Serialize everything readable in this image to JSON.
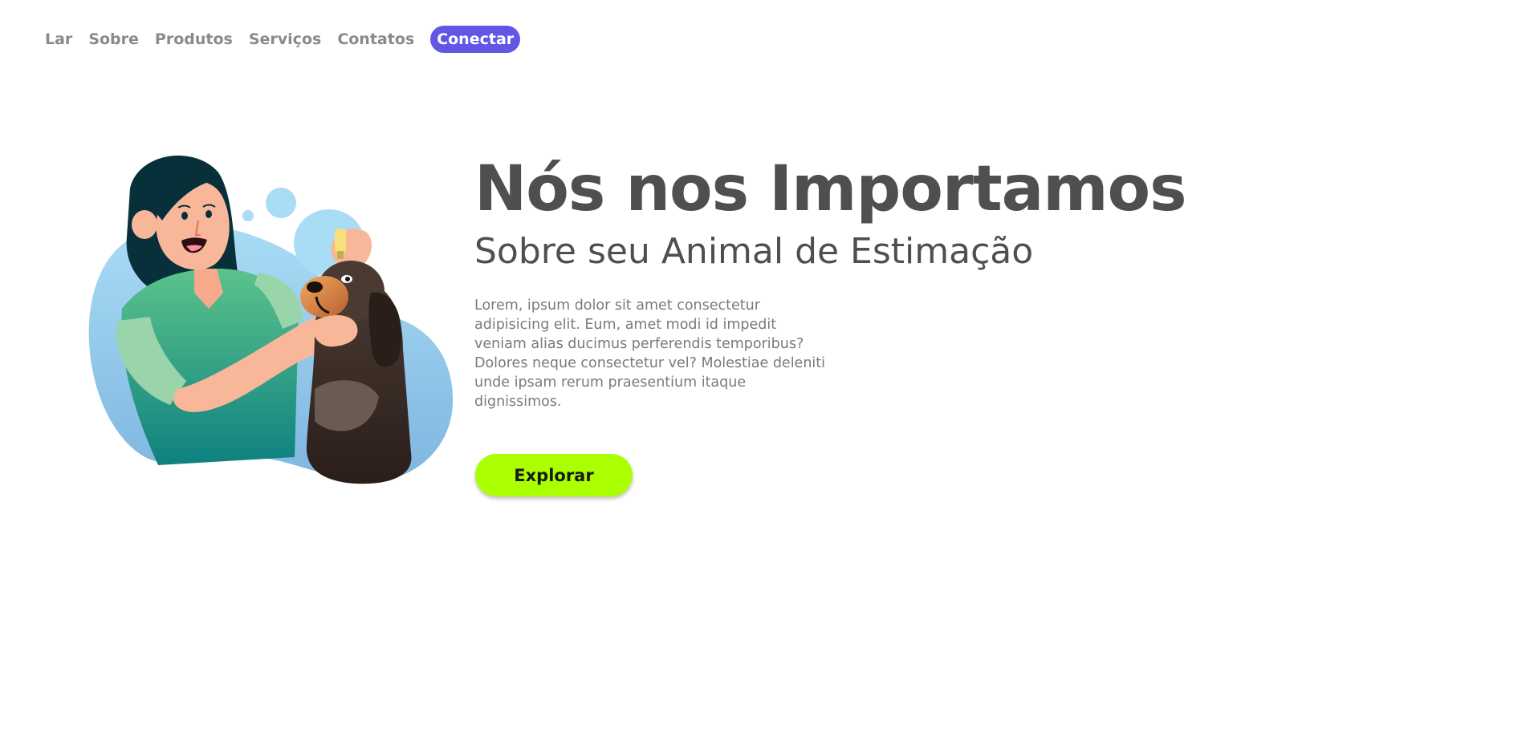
{
  "nav": {
    "items": [
      {
        "label": "Lar"
      },
      {
        "label": "Sobre"
      },
      {
        "label": "Produtos"
      },
      {
        "label": "Serviços"
      },
      {
        "label": "Contatos"
      }
    ],
    "cta_label": "Conectar"
  },
  "hero": {
    "title": "Nós nos Importamos",
    "subtitle": "Sobre seu Animal de Estimação",
    "description": "Lorem, ipsum dolor sit amet consectetur adipisicing elit. Eum, amet modi id impedit veniam alias ducimus perferendis temporibus? Dolores neque consectetur vel? Molestiae deleniti unde ipsam rerum praesentium itaque dignissimos.",
    "button_label": "Explorar"
  },
  "colors": {
    "accent": "#6356e5",
    "button": "#aaff00",
    "heading": "#4f4f4f",
    "text": "#7a7a7a"
  },
  "illustration": {
    "icon": "woman-giving-dog-eye-drops-illustration"
  }
}
